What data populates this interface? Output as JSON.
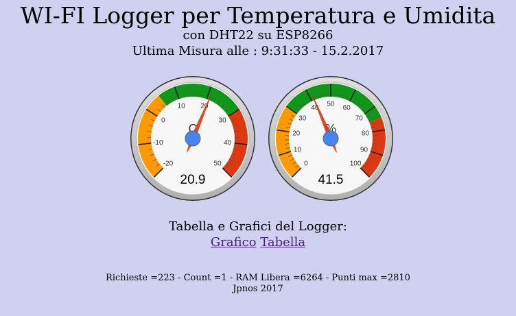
{
  "header": {
    "title": "WI-FI Logger per Temperatura e Umidita",
    "subtitle": "con DHT22 su ESP8266",
    "last_measure": "Ultima Misura alle : 9:31:33 - 15.2.2017"
  },
  "gauges": [
    {
      "name": "temperature",
      "unit": "C",
      "value": 20.9,
      "value_text": "20.9",
      "min": -20,
      "max": 50,
      "major_ticks": [
        "-20",
        "-10",
        "0",
        "10",
        "20",
        "30",
        "40",
        "50"
      ],
      "bands": [
        {
          "from": -20,
          "to": 5,
          "color": "#ff9900"
        },
        {
          "from": 5,
          "to": 30,
          "color": "#109618"
        },
        {
          "from": 30,
          "to": 50,
          "color": "#dc3912"
        }
      ]
    },
    {
      "name": "humidity",
      "unit": "%",
      "value": 41.5,
      "value_text": "41.5",
      "min": 0,
      "max": 100,
      "major_ticks": [
        "0",
        "10",
        "20",
        "30",
        "40",
        "50",
        "60",
        "70",
        "80",
        "90",
        "100"
      ],
      "bands": [
        {
          "from": 0,
          "to": 30,
          "color": "#ff9900"
        },
        {
          "from": 30,
          "to": 75,
          "color": "#109618"
        },
        {
          "from": 75,
          "to": 100,
          "color": "#dc3912"
        }
      ]
    }
  ],
  "colors": {
    "background": "#d0d0f0",
    "needle": "#dc3912",
    "needle_hub": "#4684ee",
    "link": "#551a8b"
  },
  "logger": {
    "heading": "Tabella e Grafici del Logger:",
    "links": [
      {
        "label": "Grafico"
      },
      {
        "label": "Tabella"
      }
    ]
  },
  "footer": {
    "stats": "Richieste =223 - Count =1 - RAM Libera =6264 - Punti max =2810",
    "author": "Jpnos 2017"
  }
}
